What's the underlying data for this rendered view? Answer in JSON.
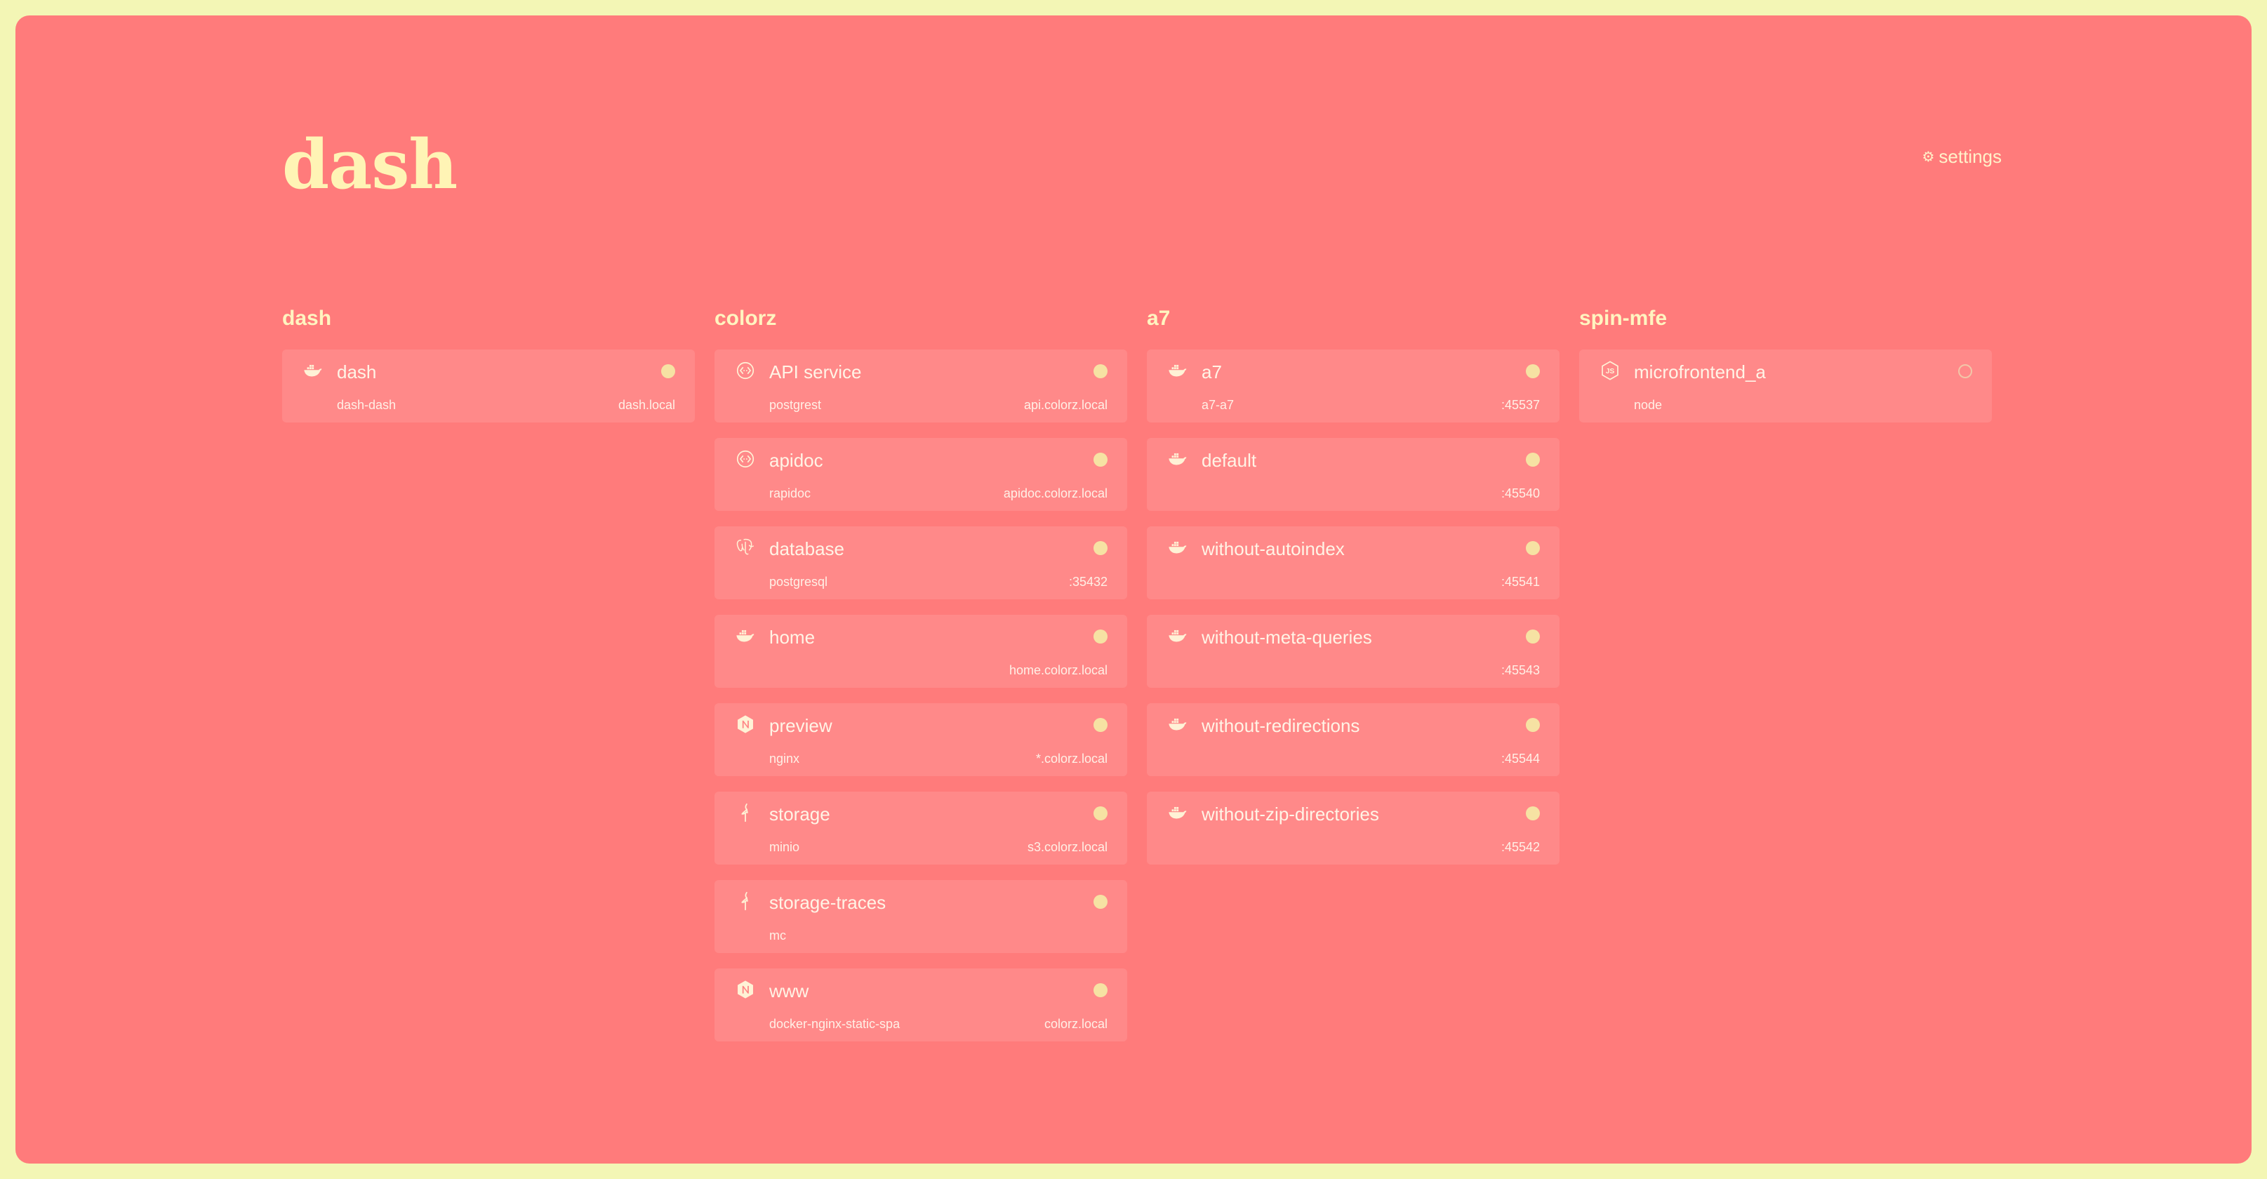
{
  "title": "dash",
  "settings": {
    "label": "settings",
    "icon": "gear-icon"
  },
  "columns": [
    {
      "name": "dash",
      "cards": [
        {
          "name": "dash",
          "icon": "docker-whale-icon",
          "sub": "dash-dash",
          "addr": "dash.local",
          "status": "running"
        }
      ]
    },
    {
      "name": "colorz",
      "cards": [
        {
          "name": "API service",
          "icon": "api-icon",
          "sub": "postgrest",
          "addr": "api.colorz.local",
          "status": "running"
        },
        {
          "name": "apidoc",
          "icon": "api-icon",
          "sub": "rapidoc",
          "addr": "apidoc.colorz.local",
          "status": "running"
        },
        {
          "name": "database",
          "icon": "postgresql-elephant-icon",
          "sub": "postgresql",
          "addr": ":35432",
          "status": "running"
        },
        {
          "name": "home",
          "icon": "docker-whale-icon",
          "sub": "",
          "addr": "home.colorz.local",
          "status": "running"
        },
        {
          "name": "preview",
          "icon": "nginx-icon",
          "sub": "nginx",
          "addr": "*.colorz.local",
          "status": "running"
        },
        {
          "name": "storage",
          "icon": "minio-flamingo-icon",
          "sub": "minio",
          "addr": "s3.colorz.local",
          "status": "running"
        },
        {
          "name": "storage-traces",
          "icon": "minio-flamingo-icon",
          "sub": "mc",
          "addr": "",
          "status": "running"
        },
        {
          "name": "www",
          "icon": "nginx-icon",
          "sub": "docker-nginx-static-spa",
          "addr": "colorz.local",
          "status": "running"
        }
      ]
    },
    {
      "name": "a7",
      "cards": [
        {
          "name": "a7",
          "icon": "docker-whale-icon",
          "sub": "a7-a7",
          "addr": ":45537",
          "status": "running"
        },
        {
          "name": "default",
          "icon": "docker-whale-icon",
          "sub": "",
          "addr": ":45540",
          "status": "running"
        },
        {
          "name": "without-autoindex",
          "icon": "docker-whale-icon",
          "sub": "",
          "addr": ":45541",
          "status": "running"
        },
        {
          "name": "without-meta-queries",
          "icon": "docker-whale-icon",
          "sub": "",
          "addr": ":45543",
          "status": "running"
        },
        {
          "name": "without-redirections",
          "icon": "docker-whale-icon",
          "sub": "",
          "addr": ":45544",
          "status": "running"
        },
        {
          "name": "without-zip-directories",
          "icon": "docker-whale-icon",
          "sub": "",
          "addr": ":45542",
          "status": "running"
        }
      ]
    },
    {
      "name": "spin-mfe",
      "cards": [
        {
          "name": "microfrontend_a",
          "icon": "nodejs-hexagon-icon",
          "sub": "node",
          "addr": "",
          "status": "stopped"
        }
      ]
    }
  ]
}
